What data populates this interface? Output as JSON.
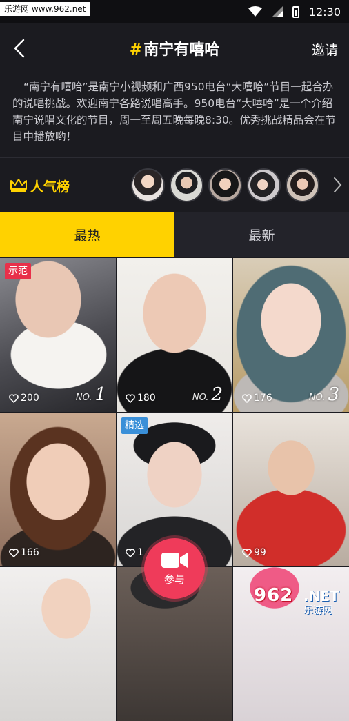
{
  "watermark_top": "乐游网 www.962.net",
  "status_bar": {
    "time": "12:30"
  },
  "nav": {
    "back_icon": "chevron-left-icon",
    "title": "南宁有嘻哈",
    "hash": "#",
    "invite": "邀请"
  },
  "description": "“南宁有嘻哈”是南宁小视频和广西950电台“大嘻哈”节目一起合办的说唱挑战。欢迎南宁各路说唱高手。950电台“大嘻哈”是一个介绍南宁说唱文化的节目，周一至周五晚每晚8:30。优秀挑战精品会在节目中播放哟！",
  "popular": {
    "label": "人气榜",
    "icon": "crown-icon",
    "accent": "#ffd200"
  },
  "tabs": [
    {
      "label": "最热",
      "active": true
    },
    {
      "label": "最新",
      "active": false
    }
  ],
  "videos": [
    {
      "tag": "示范",
      "likes": "200",
      "rank_prefix": "NO.",
      "rank": "1"
    },
    {
      "tag": "",
      "likes": "180",
      "rank_prefix": "NO.",
      "rank": "2"
    },
    {
      "tag": "",
      "likes": "176",
      "rank_prefix": "NO.",
      "rank": "3"
    },
    {
      "tag": "",
      "likes": "166",
      "rank_prefix": "",
      "rank": ""
    },
    {
      "tag": "精选",
      "likes": "1",
      "rank_prefix": "",
      "rank": ""
    },
    {
      "tag": "",
      "likes": "99",
      "rank_prefix": "",
      "rank": ""
    }
  ],
  "join_button": {
    "label": "参与",
    "icon": "video-camera-icon",
    "color": "#ef3b5a"
  },
  "watermark": {
    "number": "962",
    "net": ".NET",
    "sub": "乐游网"
  }
}
